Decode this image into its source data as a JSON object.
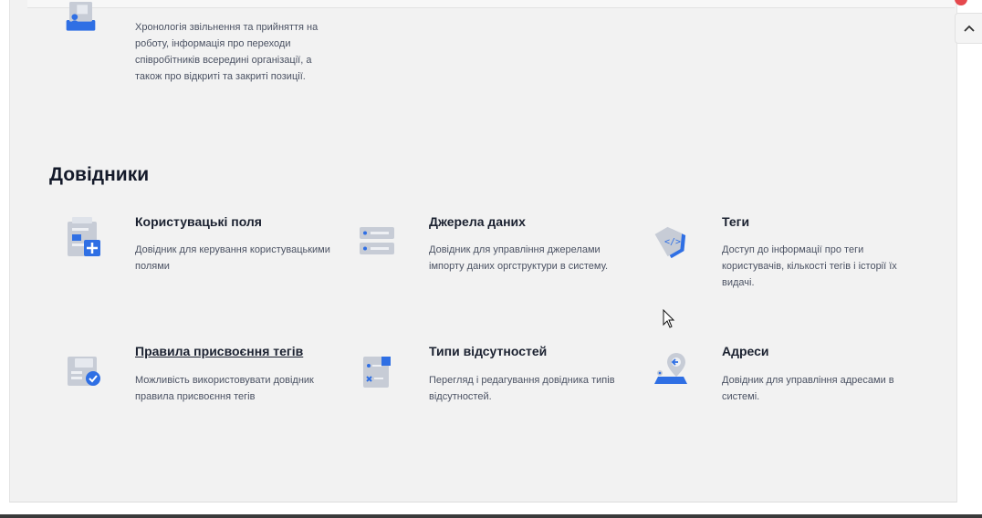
{
  "top_card": {
    "icon": "org-chart-icon",
    "description": "Хронологія звільнення та прийняття на роботу, інформація про переходи співробітників всередині організації, а також про відкриті та закриті позиції."
  },
  "section": {
    "title": "Довідники"
  },
  "cards": [
    {
      "title": "Користувацькі поля",
      "description": "Довідник для керування користувацькими полями",
      "icon": "custom-fields-icon"
    },
    {
      "title": "Джерела даних",
      "description": "Довідник для управління джерелами імпорту даних оргструктури в систему.",
      "icon": "data-sources-icon"
    },
    {
      "title": "Теги",
      "description": "Доступ до інформації про теги користувачів, кількості тегів і історії їх видачі.",
      "icon": "tags-icon"
    },
    {
      "title": "Правила присвоєння тегів",
      "description": "Можливість використовувати довідник правила присвоєння тегів",
      "icon": "tag-rules-icon"
    },
    {
      "title": "Типи відсутностей",
      "description": "Перегляд і редагування довідника типів відсутностей.",
      "icon": "absence-types-icon"
    },
    {
      "title": "Адреси",
      "description": "Довідник для управління адресами в системі.",
      "icon": "addresses-icon"
    }
  ],
  "scroll_top_icon": "chevron-up-icon",
  "colors": {
    "accent": "#2f6fe4",
    "panel_bg": "#f2f2f2",
    "icon_gray": "#c7ccd6"
  }
}
